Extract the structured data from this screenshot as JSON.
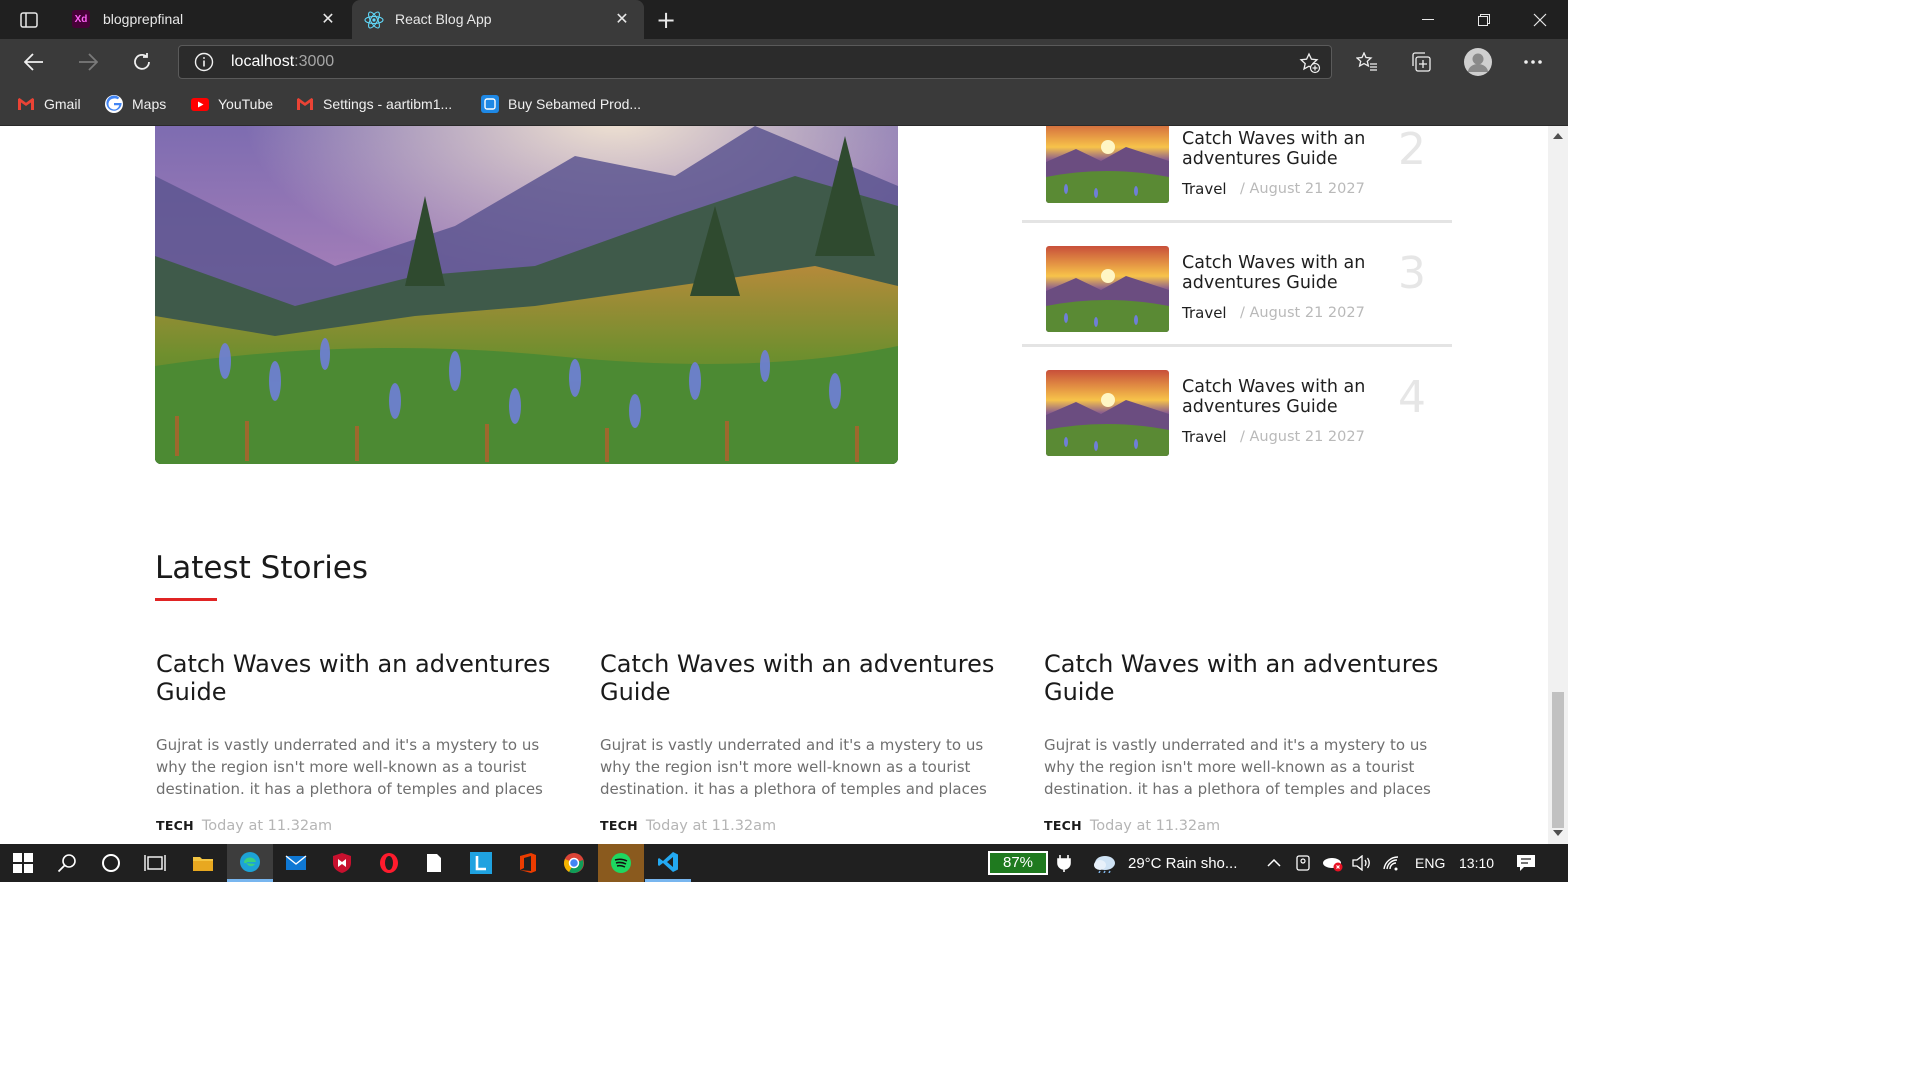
{
  "browser": {
    "tabs": [
      {
        "title": "blogprepfinal",
        "icon": "adobe-xd-icon"
      },
      {
        "title": "React Blog App",
        "icon": "react-icon",
        "active": true
      }
    ],
    "address": {
      "host": "localhost",
      "port": ":3000"
    },
    "bookmarks": [
      {
        "label": "Gmail",
        "icon": "gmail-icon"
      },
      {
        "label": "Maps",
        "icon": "google-icon"
      },
      {
        "label": "YouTube",
        "icon": "youtube-icon"
      },
      {
        "label": "Settings - aartibm1...",
        "icon": "gmail-icon"
      },
      {
        "label": "Buy Sebamed Prod...",
        "icon": "bookmark-site-icon"
      }
    ]
  },
  "sidebar_posts": [
    {
      "title": "Catch Waves with an adventures Guide",
      "category": "Travel",
      "date": "/ August 21 2027",
      "number": "2"
    },
    {
      "title": "Catch Waves with an adventures Guide",
      "category": "Travel",
      "date": "/ August 21 2027",
      "number": "3"
    },
    {
      "title": "Catch Waves with an adventures Guide",
      "category": "Travel",
      "date": "/ August 21 2027",
      "number": "4"
    }
  ],
  "latest": {
    "heading": "Latest Stories",
    "stories": [
      {
        "title": "Catch Waves with an adventures Guide",
        "excerpt": "Gujrat is vastly underrated and it's a mystery to us why the region isn't more well-known as a tourist destination. it has a plethora of temples and places",
        "tag": "TECH",
        "time": "Today at 11.32am"
      },
      {
        "title": "Catch Waves with an adventures Guide",
        "excerpt": "Gujrat is vastly underrated and it's a mystery to us why the region isn't more well-known as a tourist destination. it has a plethora of temples and places",
        "tag": "TECH",
        "time": "Today at 11.32am"
      },
      {
        "title": "Catch Waves with an adventures Guide",
        "excerpt": "Gujrat is vastly underrated and it's a mystery to us why the region isn't more well-known as a tourist destination. it has a plethora of temples and places",
        "tag": "TECH",
        "time": "Today at 11.32am"
      }
    ]
  },
  "taskbar": {
    "battery": "87%",
    "weather": "29°C  Rain sho...",
    "language": "ENG",
    "clock": "13:10"
  },
  "colors": {
    "accent": "#e02424",
    "chrome_dark": "#202020",
    "chrome_mid": "#3a3a3a"
  }
}
